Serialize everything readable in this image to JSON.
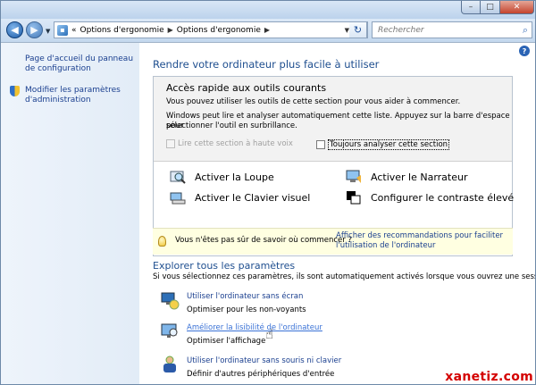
{
  "titlebar": {
    "minimize": "–",
    "maximize": "□",
    "close": "✕"
  },
  "nav": {
    "back": "◀",
    "forward": "▶",
    "overflow": "«",
    "breadcrumbs": [
      "Options d'ergonomie",
      "Options d'ergonomie"
    ],
    "search_placeholder": "Rechercher"
  },
  "left_pane": {
    "home_link": "Page d'accueil du panneau de configuration",
    "admin_link": "Modifier les paramètres d'administration"
  },
  "main": {
    "title": "Rendre votre ordinateur plus facile à utiliser",
    "quick": {
      "title": "Accès rapide aux outils courants",
      "line1": "Vous pouvez utiliser les outils de cette section pour vous aider à commencer.",
      "line2": "Windows peut lire et analyser automatiquement cette liste. Appuyez sur la barre d'espace pour",
      "line3": "sélectionner l'outil en surbrillance.",
      "chk_read": "Lire cette section à haute voix",
      "chk_scan": "Toujours analyser cette section",
      "tools": {
        "magnifier": "Activer la Loupe",
        "narrator": "Activer le Narrateur",
        "keyboard": "Activer le Clavier visuel",
        "contrast": "Configurer le contraste élevé"
      }
    },
    "tip": {
      "question": "Vous n'êtes pas sûr de savoir où commencer ?",
      "link": "Afficher des recommandations pour faciliter l'utilisation de l'ordinateur"
    },
    "explore": {
      "title": "Explorer tous les paramètres",
      "subtitle": "Si vous sélectionnez ces paramètres, ils sont automatiquement activés lorsque vous ouvrez une session.",
      "items": [
        {
          "link": "Utiliser l'ordinateur sans écran",
          "desc": "Optimiser pour les non-voyants"
        },
        {
          "link": "Améliorer la lisibilité de l'ordinateur",
          "desc": "Optimiser l'affichage"
        },
        {
          "link": "Utiliser l'ordinateur sans souris ni clavier",
          "desc": "Définir d'autres périphériques d'entrée"
        }
      ]
    }
  },
  "watermark": "xanetiz.com",
  "colors": {
    "link": "#1a3f8f",
    "heading": "#1e4e8f",
    "tip_bg": "#ffffe1"
  }
}
